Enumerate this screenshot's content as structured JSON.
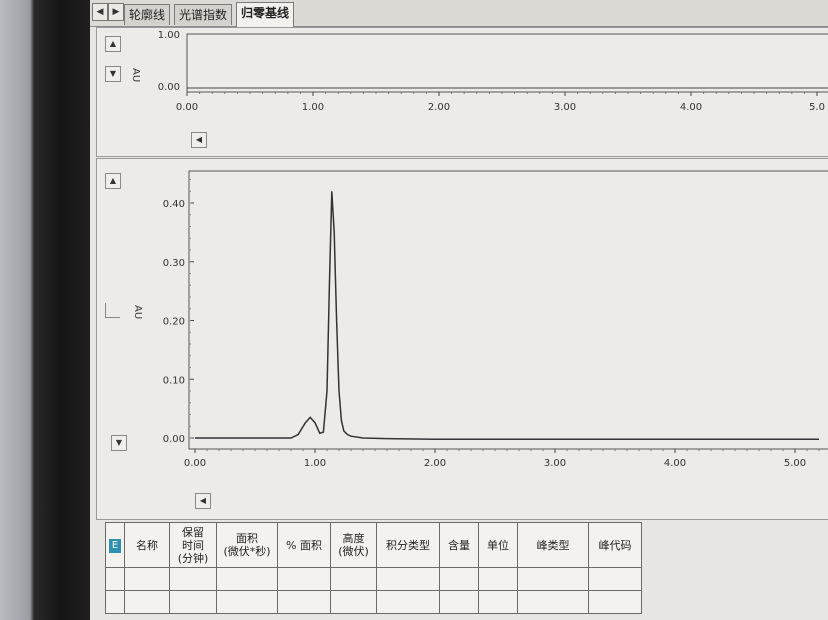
{
  "tabs": [
    {
      "label": "轮廓线",
      "active": false
    },
    {
      "label": "光谱指数",
      "active": false
    },
    {
      "label": "归零基线",
      "active": true
    }
  ],
  "top_chart": {
    "ylabel": "AU",
    "y_ticks": [
      "1.00",
      "0.00"
    ],
    "x_ticks": [
      "0.00",
      "1.00",
      "2.00",
      "3.00",
      "4.00",
      "5.0"
    ]
  },
  "main_chart": {
    "ylabel": "AU",
    "y_ticks": [
      "0.40",
      "0.30",
      "0.20",
      "0.10",
      "0.00"
    ],
    "x_ticks": [
      "0.00",
      "1.00",
      "2.00",
      "3.00",
      "4.00",
      "5.00"
    ]
  },
  "chart_data": [
    {
      "type": "line",
      "ylabel": "AU",
      "ylim": [
        0,
        1
      ],
      "xlim": [
        0,
        5
      ],
      "series": [
        {
          "x": [
            0,
            5
          ],
          "y": [
            0,
            0
          ]
        }
      ]
    },
    {
      "type": "line",
      "ylabel": "AU",
      "ylim": [
        0,
        0.45
      ],
      "xlim": [
        0,
        5.2
      ],
      "series": [
        {
          "x": [
            0.0,
            0.5,
            0.8,
            0.86,
            0.92,
            0.96,
            1.0,
            1.04,
            1.07,
            1.1,
            1.12,
            1.14,
            1.16,
            1.18,
            1.2,
            1.22,
            1.24,
            1.27,
            1.3,
            1.4,
            1.6,
            2.0,
            3.0,
            4.0,
            5.0,
            5.2
          ],
          "y": [
            0.0,
            0.0,
            0.0,
            0.006,
            0.026,
            0.035,
            0.026,
            0.008,
            0.01,
            0.08,
            0.26,
            0.42,
            0.35,
            0.2,
            0.08,
            0.03,
            0.012,
            0.006,
            0.003,
            0.0,
            -0.001,
            -0.002,
            -0.002,
            -0.002,
            -0.002,
            -0.002
          ]
        }
      ]
    }
  ],
  "results_table": {
    "headers": [
      "名称",
      "保留\n时间\n(分钟)",
      "面积\n(微伏*秒)",
      "% 面积",
      "高度\n(微伏)",
      "积分类型",
      "含量",
      "单位",
      "峰类型",
      "峰代码"
    ],
    "rows": [
      [
        "",
        "",
        "",
        "",
        "",
        "",
        "",
        "",
        "",
        ""
      ],
      [
        "",
        "",
        "",
        "",
        "",
        "",
        "",
        "",
        "",
        ""
      ]
    ]
  }
}
